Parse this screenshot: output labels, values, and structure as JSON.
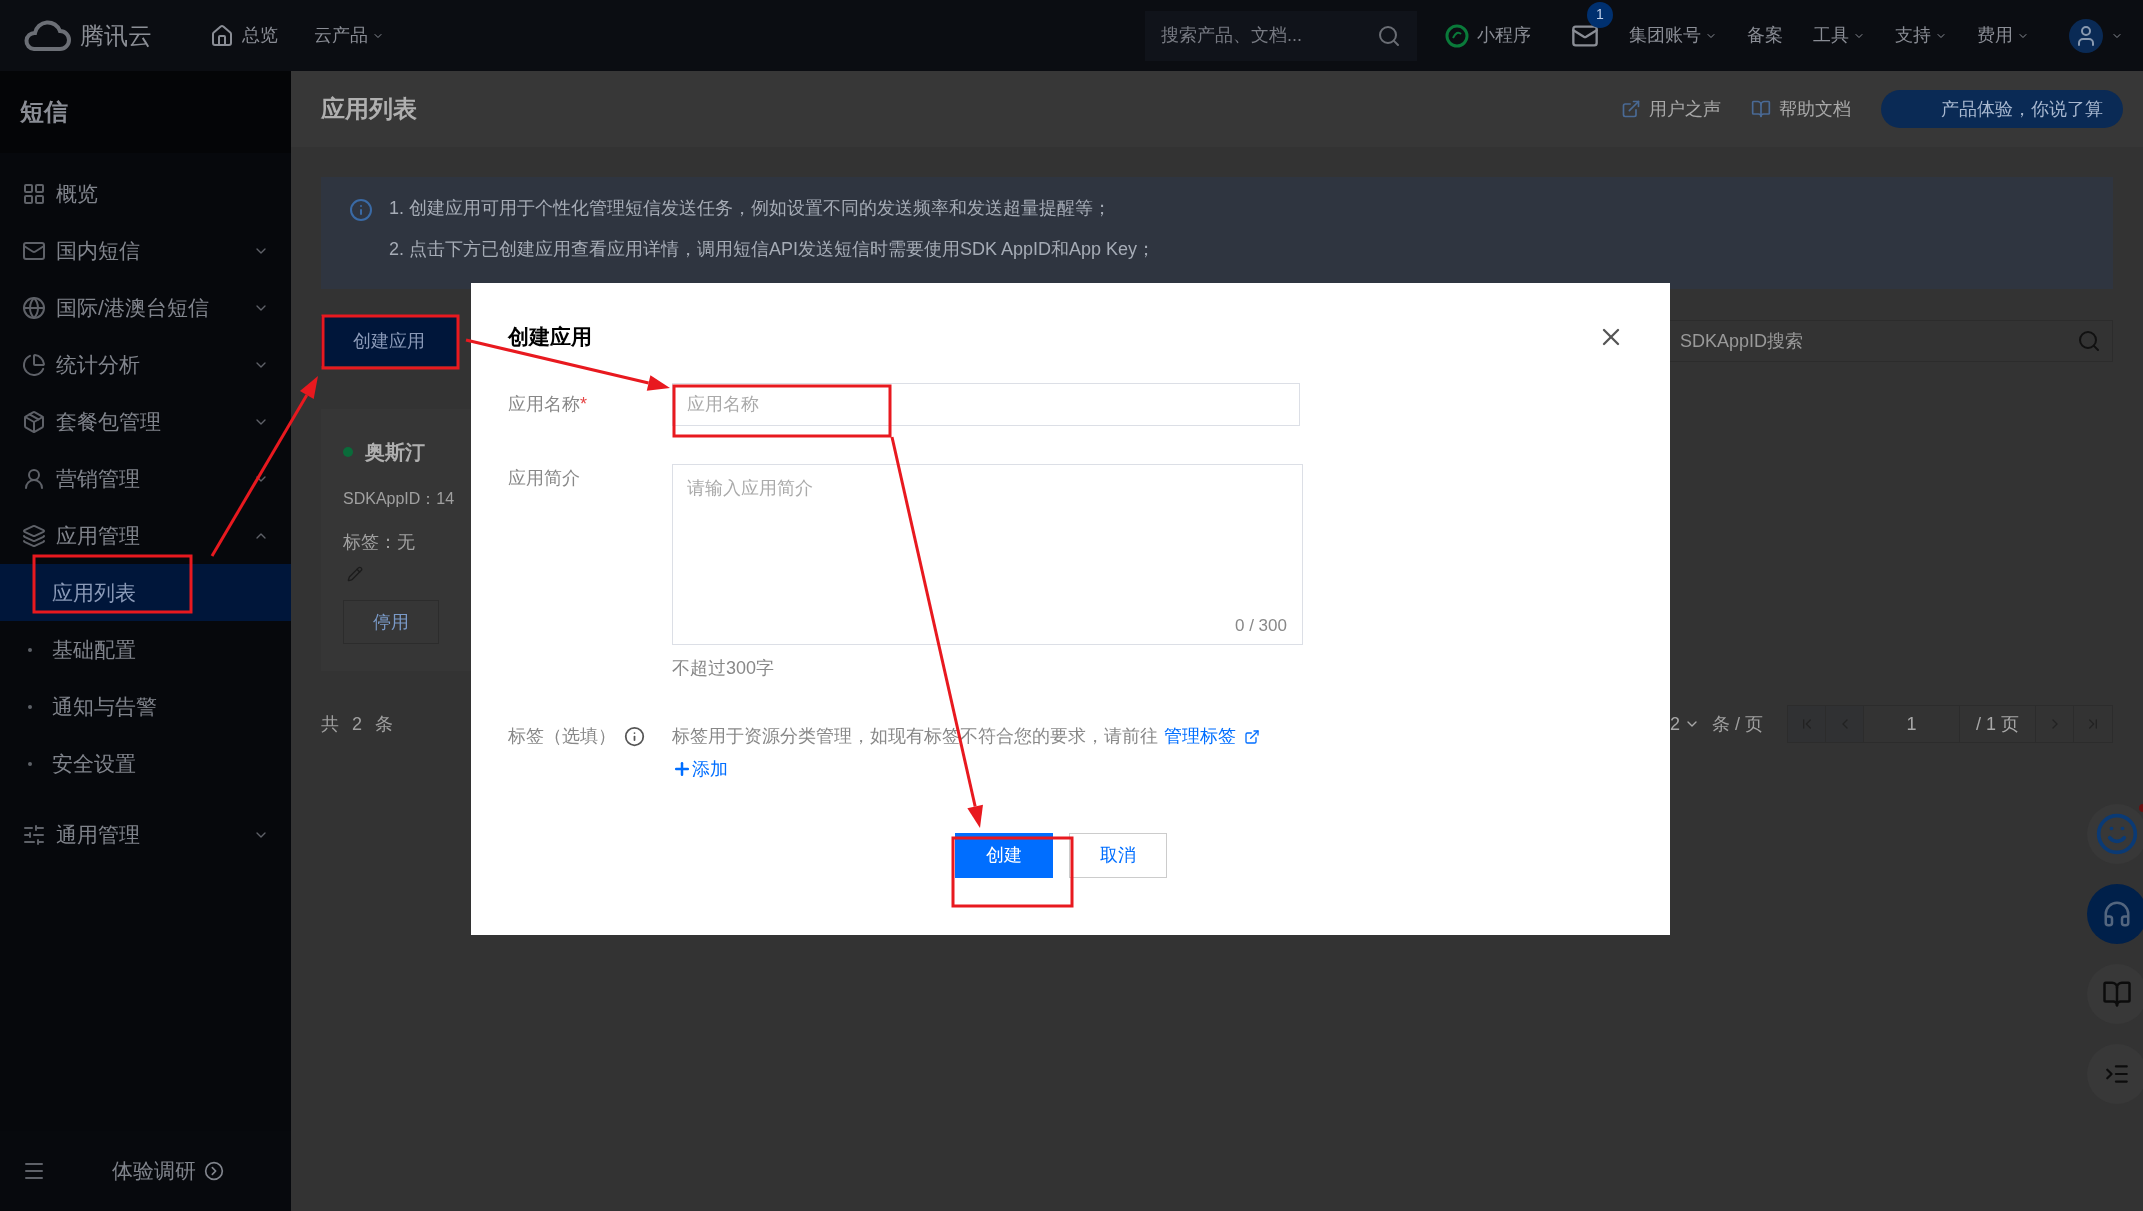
{
  "top_bar": {
    "logo": "腾讯云",
    "nav": [
      {
        "label": "总览",
        "dropdown": false
      },
      {
        "label": "云产品",
        "dropdown": true
      }
    ],
    "search": {
      "placeholder": "搜索产品、文档..."
    },
    "links": [
      {
        "kind": "miniapp",
        "label": "小程序",
        "dropdown": false
      },
      {
        "kind": "mail",
        "badge": "1"
      },
      {
        "kind": "text",
        "label": "集团账号",
        "dropdown": true
      },
      {
        "kind": "text",
        "label": "备案",
        "dropdown": false
      },
      {
        "kind": "text",
        "label": "工具",
        "dropdown": true
      },
      {
        "kind": "text",
        "label": "支持",
        "dropdown": true
      },
      {
        "kind": "text",
        "label": "费用",
        "dropdown": true
      },
      {
        "kind": "avatar",
        "dropdown": true
      }
    ]
  },
  "sidebar": {
    "title": "短信",
    "items": [
      {
        "kind": "link",
        "label": "概览"
      },
      {
        "kind": "group",
        "label": "国内短信",
        "expanded": false
      },
      {
        "kind": "group",
        "label": "国际/港澳台短信",
        "expanded": false
      },
      {
        "kind": "group",
        "label": "统计分析",
        "expanded": false
      },
      {
        "kind": "group",
        "label": "套餐包管理",
        "expanded": false
      },
      {
        "kind": "group",
        "label": "营销管理",
        "expanded": false
      },
      {
        "kind": "group",
        "label": "应用管理",
        "expanded": true,
        "children": [
          {
            "label": "应用列表",
            "selected": true
          },
          {
            "label": "基础配置",
            "selected": false
          },
          {
            "label": "通知与告警",
            "selected": false
          },
          {
            "label": "安全设置",
            "selected": false
          }
        ]
      },
      {
        "kind": "group",
        "label": "通用管理",
        "expanded": false
      }
    ],
    "footer": "体验调研"
  },
  "header": {
    "title": "应用列表",
    "links": [
      "用户之声",
      "帮助文档"
    ],
    "promo": "产品体验，你说了算"
  },
  "notice": {
    "lines": [
      "1. 创建应用可用于个性化管理短信发送任务，例如设置不同的发送频率和发送超量提醒等；",
      "2. 点击下方已创建应用查看应用详情，调用短信API发送短信时需要使用SDK AppID和App Key；"
    ]
  },
  "toolbar": {
    "create_button": "创建应用",
    "search_placeholder": "SDKAppID搜索"
  },
  "app_card": {
    "name": "奥斯汀",
    "color": "#0a6b3a",
    "appid": "SDKAppID：14",
    "tags": "标签：无",
    "button": "停用"
  },
  "list_footer": {
    "total": "共 2 条",
    "page_size": "2",
    "per_page": "条 / 页",
    "page": "1",
    "page_total": "/ 1 页"
  },
  "dialog": {
    "title": "创建应用",
    "required_mark": "*",
    "fields": [
      {
        "kind": "input",
        "label": "应用名称",
        "required": true,
        "placeholder": "应用名称"
      },
      {
        "kind": "textarea",
        "label": "应用简介",
        "required": false,
        "placeholder": "请输入应用简介",
        "counter": "0 / 300",
        "hint": "不超过300字"
      },
      {
        "kind": "tags",
        "label": "标签（选填）",
        "required": false,
        "description": "标签用于资源分类管理，如现有标签不符合您的要求，请前往",
        "link": "管理标签",
        "add": "添加"
      }
    ],
    "buttons": [
      {
        "label": "创建",
        "primary": true
      },
      {
        "label": "取消",
        "primary": false
      }
    ]
  }
}
